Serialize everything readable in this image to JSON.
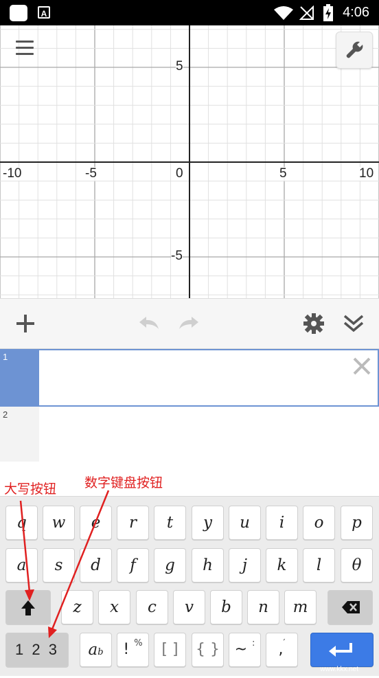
{
  "status_bar": {
    "time": "4:06",
    "notification_letter": "A"
  },
  "graph": {
    "x_ticks": [
      "-10",
      "-5",
      "0",
      "5",
      "10"
    ],
    "y_ticks": [
      "5",
      "-5"
    ]
  },
  "expressions": [
    {
      "index": "1",
      "value": ""
    },
    {
      "index": "2",
      "value": ""
    }
  ],
  "annotations": {
    "caps_label": "大写按钮",
    "numpad_label": "数字键盘按钮"
  },
  "keyboard": {
    "row1": [
      "q",
      "w",
      "e",
      "r",
      "t",
      "y",
      "u",
      "i",
      "o",
      "p"
    ],
    "row2": [
      "a",
      "s",
      "d",
      "f",
      "g",
      "h",
      "j",
      "k",
      "l",
      "θ"
    ],
    "row3": [
      "z",
      "x",
      "c",
      "v",
      "b",
      "n",
      "m"
    ],
    "row4": {
      "numbers": "1 2 3",
      "subscript_main": "a",
      "subscript_sub": "b",
      "factorial": "!",
      "percent": "%",
      "brackets": "[ ]",
      "braces": "{ }",
      "tilde": "~",
      "colon": ":",
      "comma": ",",
      "prime": "′"
    }
  },
  "watermark": "www.kkx.net",
  "colors": {
    "accent": "#6d93d3",
    "enter_key": "#3c7be6",
    "annotation": "#e02020"
  }
}
